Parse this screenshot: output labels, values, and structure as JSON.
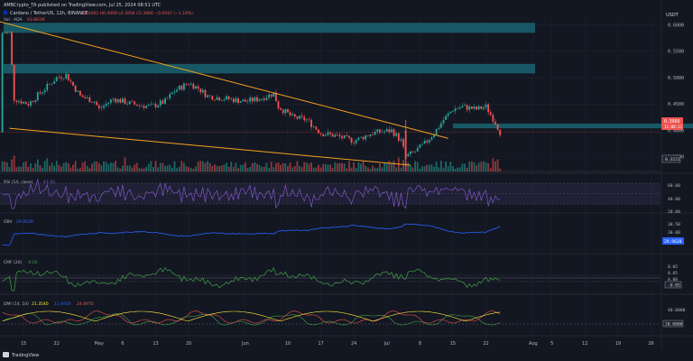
{
  "header": {
    "publisher": "AMBCrypto_TA published on TradingView.com, Jul 25, 2024 08:51 UTC",
    "symbol": "Cardano / TetherUS, 12h, BINANCE",
    "ohlc": "O0.4002 H0.4008 L0.3958 C0.3966 −0.0047 (−1.19%)",
    "vol_label": "Vol · ADA",
    "vol_value": "83.881M"
  },
  "footer": {
    "brand": "TradingView"
  },
  "colors": {
    "background": "#131722",
    "up": "#26a69a",
    "down": "#ef5350",
    "zone": "#1a6470",
    "trendline": "#f7a21b",
    "rsi": "#7e57c2",
    "obv": "#2962ff",
    "cmf": "#43a047",
    "dmi_plus": "#2962ff",
    "dmi_minus": "#ff6d00",
    "adx": "#e91e63",
    "last_price_tag": "#ef5350"
  },
  "chart_data": [
    {
      "type": "candlestick",
      "panel": "price",
      "title": "Cardano / TetherUS, 12h, BINANCE",
      "currency_label": "USDT",
      "y_ticks": [
        "0.6000",
        "0.5500",
        "0.5000",
        "0.4500",
        "0.4000",
        "0.3500"
      ],
      "ylim": [
        0.3221,
        0.613
      ],
      "last_price": "0.3966",
      "countdown": "11:08:11",
      "low_label": "0.3221",
      "x_ticks": [
        "15",
        "22",
        "May",
        "6",
        "13",
        "20",
        "Jun",
        "10",
        "17",
        "24",
        "Jul",
        "8",
        "15",
        "22",
        "Aug",
        "5",
        "12",
        "19",
        "26"
      ],
      "zones": [
        {
          "from": 0.585,
          "to": 0.604
        },
        {
          "from": 0.508,
          "to": 0.526
        },
        {
          "from": 0.404,
          "to": 0.413
        }
      ],
      "trendlines": [
        {
          "from": {
            "x": "Apr 10",
            "y": 0.606
          },
          "to": {
            "x": "Jul 14",
            "y": 0.385
          }
        },
        {
          "from": {
            "x": "Apr 12",
            "y": 0.404
          },
          "to": {
            "x": "Jul 6",
            "y": 0.334
          }
        }
      ],
      "close_path": [
        {
          "x": "Apr 12",
          "y": 0.585
        },
        {
          "x": "Apr 13",
          "y": 0.46
        },
        {
          "x": "Apr 16",
          "y": 0.45
        },
        {
          "x": "Apr 19",
          "y": 0.475
        },
        {
          "x": "Apr 22",
          "y": 0.5
        },
        {
          "x": "Apr 24",
          "y": 0.505
        },
        {
          "x": "Apr 27",
          "y": 0.465
        },
        {
          "x": "Apr 30",
          "y": 0.455
        },
        {
          "x": "May 1",
          "y": 0.44
        },
        {
          "x": "May 4",
          "y": 0.46
        },
        {
          "x": "May 8",
          "y": 0.45
        },
        {
          "x": "May 12",
          "y": 0.445
        },
        {
          "x": "May 15",
          "y": 0.455
        },
        {
          "x": "May 17",
          "y": 0.475
        },
        {
          "x": "May 20",
          "y": 0.49
        },
        {
          "x": "May 22",
          "y": 0.48
        },
        {
          "x": "May 24",
          "y": 0.465
        },
        {
          "x": "May 28",
          "y": 0.46
        },
        {
          "x": "Jun 1",
          "y": 0.455
        },
        {
          "x": "Jun 4",
          "y": 0.46
        },
        {
          "x": "Jun 7",
          "y": 0.47
        },
        {
          "x": "Jun 8",
          "y": 0.445
        },
        {
          "x": "Jun 11",
          "y": 0.425
        },
        {
          "x": "Jun 14",
          "y": 0.42
        },
        {
          "x": "Jun 17",
          "y": 0.395
        },
        {
          "x": "Jun 20",
          "y": 0.39
        },
        {
          "x": "Jun 24",
          "y": 0.38
        },
        {
          "x": "Jun 28",
          "y": 0.395
        },
        {
          "x": "Jul 2",
          "y": 0.4
        },
        {
          "x": "Jul 4",
          "y": 0.38
        },
        {
          "x": "Jul 5",
          "y": 0.35
        },
        {
          "x": "Jul 7",
          "y": 0.36
        },
        {
          "x": "Jul 9",
          "y": 0.375
        },
        {
          "x": "Jul 11",
          "y": 0.395
        },
        {
          "x": "Jul 13",
          "y": 0.42
        },
        {
          "x": "Jul 15",
          "y": 0.44
        },
        {
          "x": "Jul 17",
          "y": 0.445
        },
        {
          "x": "Jul 20",
          "y": 0.44
        },
        {
          "x": "Jul 22",
          "y": 0.445
        },
        {
          "x": "Jul 24",
          "y": 0.415
        },
        {
          "x": "Jul 25",
          "y": 0.3966
        }
      ]
    },
    {
      "type": "bar",
      "panel": "volume",
      "title": "Vol · ADA",
      "series": [
        {
          "name": "Vol · ADA",
          "last_value": "83.881M"
        }
      ]
    },
    {
      "type": "line",
      "panel": "rsi",
      "title": "RSI (14, close)",
      "legend_value": "41.40",
      "y_ticks": [
        "60.00",
        "40.00",
        "20.00"
      ],
      "band": [
        30,
        70
      ],
      "ylim": [
        20,
        80
      ]
    },
    {
      "type": "line",
      "panel": "obv",
      "title": "OBV",
      "legend_value": "29.962B",
      "y_ticks": [
        "30.5B",
        "30.0B"
      ],
      "last_value": "29.962B"
    },
    {
      "type": "line",
      "panel": "cmf",
      "title": "CMF (20)",
      "legend_value": "-0.05",
      "y_ticks": [
        "0.05",
        "0.00",
        "-0.05"
      ],
      "value_tag": "-0.05",
      "ylim": [
        -0.15,
        0.2
      ]
    },
    {
      "type": "line",
      "panel": "dmi",
      "title": "DMI (14, 14)",
      "legend_values": [
        "21.3540",
        "11.6950",
        "24.8970"
      ],
      "y_ticks": [
        "40.0000",
        "20.0000"
      ],
      "value_tag": "20.0000",
      "series": [
        {
          "name": "+DI",
          "last_value": "21.3540"
        },
        {
          "name": "−DI",
          "last_value": "11.6950"
        },
        {
          "name": "ADX",
          "last_value": "24.8970"
        }
      ],
      "ylim": [
        0,
        60
      ]
    }
  ]
}
